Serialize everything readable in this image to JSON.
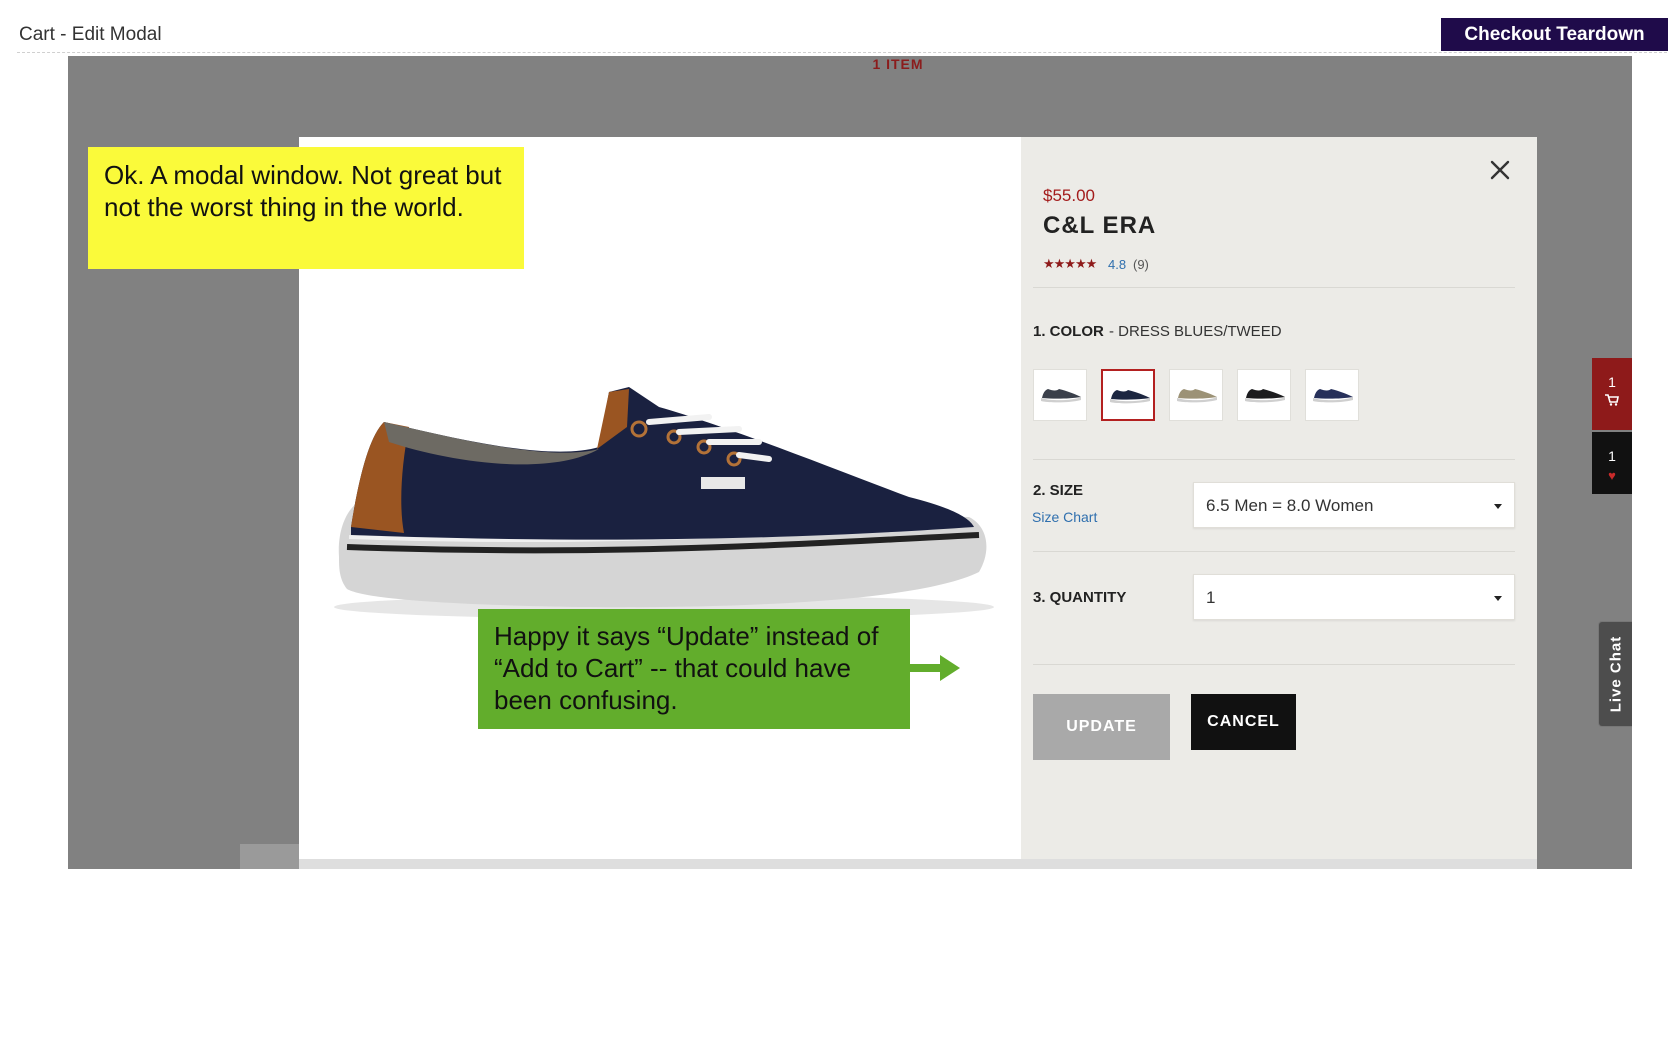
{
  "page": {
    "title": "Cart - Edit Modal",
    "brand_badge": "Checkout Teardown"
  },
  "background": {
    "items_count": "1 ITEM",
    "cart_count": "1",
    "wishlist_count": "1",
    "live_chat_label": "Live Chat",
    "cart_icon": "cart-icon",
    "heart_icon": "heart-icon"
  },
  "modal": {
    "close_icon": "close-icon",
    "price": "$55.00",
    "product_name": "C&L ERA",
    "rating": {
      "stars": "★★★★★",
      "value": "4.8",
      "count": "(9)",
      "value_out_of_5": 4.8
    },
    "color_step": {
      "label": "1. COLOR",
      "selected_color": "- DRESS BLUES/TWEED",
      "swatch_colors": [
        "#3a3f4a",
        "#1c2640",
        "#9c9276",
        "#1c1c1e",
        "#27305a"
      ],
      "selected_index": 1
    },
    "size_step": {
      "label": "2. SIZE",
      "size_chart_link": "Size Chart",
      "selected": "6.5 Men = 8.0 Women"
    },
    "quantity_step": {
      "label": "3. QUANTITY",
      "selected": "1"
    },
    "update_label": "UPDATE",
    "cancel_label": "CANCEL"
  },
  "annotations": {
    "note_1": "Ok. A modal window. Not great but not the worst thing in the world.",
    "note_2": "Happy it says “Update” instead of “Add to Cart” -- that could have been confusing."
  },
  "colors": {
    "brand_badge": "#1f0b4a",
    "accent_red": "#a31b1b",
    "note_yellow": "#fafa3a",
    "note_green": "#62ad2c",
    "overlay_gray": "#818181",
    "update_disabled": "#a9a9a9"
  }
}
